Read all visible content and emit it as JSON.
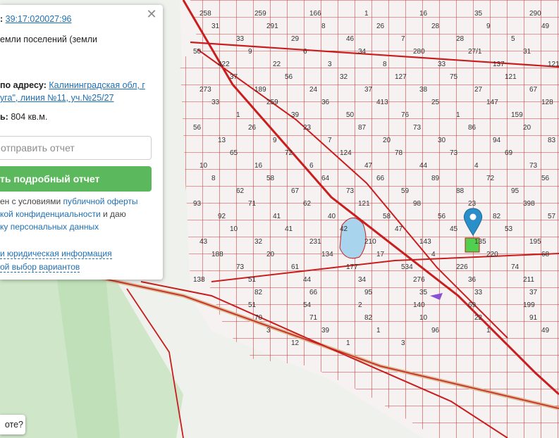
{
  "panel": {
    "cadastral_prefix": ":",
    "cadastral_number": "39:17:020027:96",
    "category_line1": "емли поселений (земли",
    "address_label": "по адресу:",
    "address_line1": "Калининградская обл, г",
    "address_line2": "уга\", линия №11, уч.№25/27",
    "area_label": "ь:",
    "area_value": "804 кв.м.",
    "send_report": "отправить отчет",
    "get_report_button": "ть подробный отчет",
    "terms_line1_text": "ен с условиями ",
    "terms_line1_link": "публичной оферты",
    "terms_line2_link": "кой конфиденциальности",
    "terms_line2_text": " и даю",
    "terms_line3_link": "ку персональных данных",
    "legal_info_link": "и юридическая информация",
    "choice_link": "ой выбор вариантов"
  },
  "chat": {
    "label": "оте?"
  },
  "map": {
    "label_color": "#333333",
    "plot_line_color": "#c81e1e",
    "marker_color": "#2a8fc9",
    "selected_plot_color": "#4fd14f",
    "labels": [
      "258",
      "259",
      "166",
      "1",
      "16",
      "35",
      "290",
      "31",
      "291",
      "8",
      "26",
      "28",
      "9",
      "49",
      "33",
      "29",
      "46",
      "7",
      "28",
      "5",
      "50",
      "9",
      "6",
      "34",
      "280",
      "27/1",
      "31",
      "422",
      "22",
      "3",
      "8",
      "33",
      "137",
      "121",
      "37",
      "56",
      "32",
      "127",
      "75",
      "121",
      "273",
      "189",
      "24",
      "37",
      "38",
      "27",
      "67",
      "33",
      "259",
      "36",
      "413",
      "25",
      "147",
      "128",
      "1",
      "39",
      "50",
      "76",
      "1",
      "159",
      "56",
      "26",
      "23",
      "87",
      "73",
      "86",
      "20",
      "13",
      "9",
      "7",
      "20",
      "30",
      "94",
      "83",
      "65",
      "72",
      "124",
      "78",
      "73",
      "69",
      "10",
      "16",
      "6",
      "47",
      "44",
      "4",
      "73",
      "8",
      "58",
      "64",
      "66",
      "89",
      "72",
      "56",
      "62",
      "67",
      "73",
      "59",
      "88",
      "95",
      "93",
      "71",
      "62",
      "121",
      "98",
      "23",
      "398",
      "92",
      "41",
      "40",
      "58",
      "56",
      "82",
      "57",
      "10",
      "41",
      "42",
      "47",
      "45",
      "53",
      "43",
      "32",
      "231",
      "210",
      "143",
      "135",
      "195",
      "188",
      "20",
      "134",
      "17",
      "4",
      "220",
      "68",
      "73",
      "61",
      "177",
      "534",
      "226",
      "74",
      "138",
      "51",
      "44",
      "34",
      "276",
      "36",
      "211",
      "82",
      "66",
      "95",
      "35",
      "33",
      "37",
      "51",
      "54",
      "2",
      "140",
      "69",
      "199",
      "70",
      "71",
      "82",
      "10",
      "22",
      "91",
      "3",
      "39",
      "1",
      "96",
      "1",
      "49",
      "12",
      "1",
      "3"
    ]
  }
}
